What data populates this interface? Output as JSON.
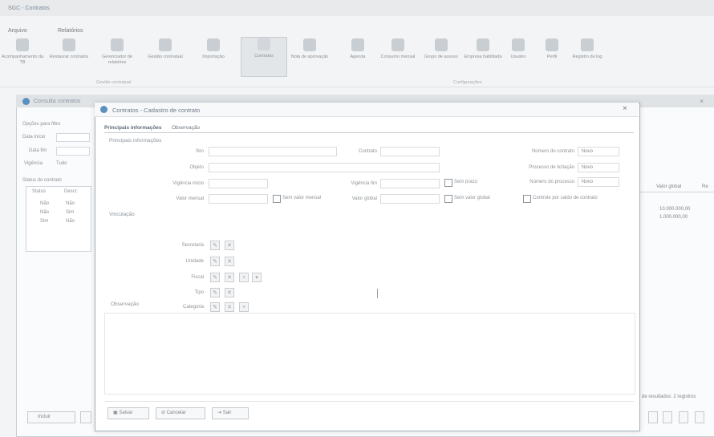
{
  "app": {
    "title": "SGC - Contratos"
  },
  "menu": {
    "items": [
      "Arquivo",
      "Relatórios"
    ]
  },
  "ribbon": {
    "buttons": [
      "Acompanhamento da TB",
      "Restaurar contratos",
      "Gerenciador de relatórios",
      "Gestão contratual",
      "Importação",
      "Contratos",
      "Nota de aprovação",
      "Agenda",
      "Consumo mensal",
      "Grupo de acesso",
      "Empresa habilitada",
      "Usuário",
      "Perfil",
      "Registro de log"
    ],
    "active_index": 5,
    "group_label_1": "Gestão contratual",
    "group_label_2": "Configurações"
  },
  "bg_form": {
    "title": "Consulta contratos",
    "options_label": "Opções para filtro",
    "date_start_label": "Data início",
    "date_end_label": "Data fim",
    "validity_label": "Vigência",
    "validity_value": "Tudo",
    "grid_title": "Status do contrato",
    "grid_header": [
      "Status",
      "Descr."
    ],
    "grid_rows": [
      [
        "Não",
        "Não"
      ],
      [
        "Não",
        "Sim"
      ],
      [
        "Sim",
        "Não"
      ]
    ],
    "add_button": "Incluir"
  },
  "right_panel": {
    "header_left": "Valor global",
    "header_right": "Re",
    "values": [
      "10.000.000,00",
      "1.000.000,00"
    ],
    "footer": "de resultados: 2 registros"
  },
  "modal": {
    "title": "Contratos - Cadastro de contrato",
    "tabs": [
      "Principais informações",
      "Observação"
    ],
    "section_main": "Principais informações",
    "fields": {
      "numero": "Nro",
      "contrato": "Contrato",
      "numero_contrato_label": "Número do contrato",
      "numero_contrato_value": "Novo",
      "objeto": "Objeto",
      "processo_label": "Processo de licitação",
      "processo_value": "Novo",
      "vigencia_inicio": "Vigência início",
      "vigencia_fim": "Vigência fim",
      "sem_prazo": "Sem prazo",
      "numero_processo_label": "Número do processo",
      "numero_processo_value": "Novo",
      "valor_mensal": "Valor mensal",
      "sem_valor_mensal": "Sem valor mensal",
      "valor_global": "Valor global",
      "sem_valor_global": "Sem valor global",
      "controle_saldo": "Controle por saldo de contrato"
    },
    "section_vinc": "Vinculação",
    "vinc_rows": [
      "Secretaria",
      "Unidade",
      "Fiscal",
      "Tipo",
      "Categoria"
    ],
    "section_notes": "Observação",
    "footer_buttons": [
      "Salvar",
      "Cancelar",
      "Sair"
    ]
  },
  "colors": {
    "accent": "#5a8fc0",
    "modal_border": "#a8b0b8"
  }
}
